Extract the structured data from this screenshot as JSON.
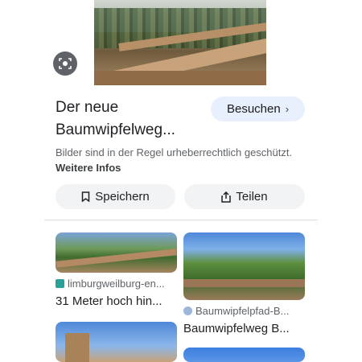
{
  "hero": {
    "image_name": "treetop-walk-photo"
  },
  "lens": {
    "icon": "lens-icon"
  },
  "result": {
    "title_line1": "Der neue",
    "title_line2": "Baumwipfelweg...",
    "visit_label": "Besuchen",
    "visit_chevron": "›",
    "notice_text": "Bilder sind in der Regel urheberrechtlich geschützt.",
    "notice_link": "Weitere Infos"
  },
  "actions": {
    "save_label": "Speichern",
    "share_label": "Teilen"
  },
  "related": [
    {
      "source": "limburgweilburg-en...",
      "caption": "31 Meter hoch hin..."
    },
    {
      "source": "Baumwipfelpfad-B...",
      "caption": "Baumwipfelweg B..."
    }
  ]
}
